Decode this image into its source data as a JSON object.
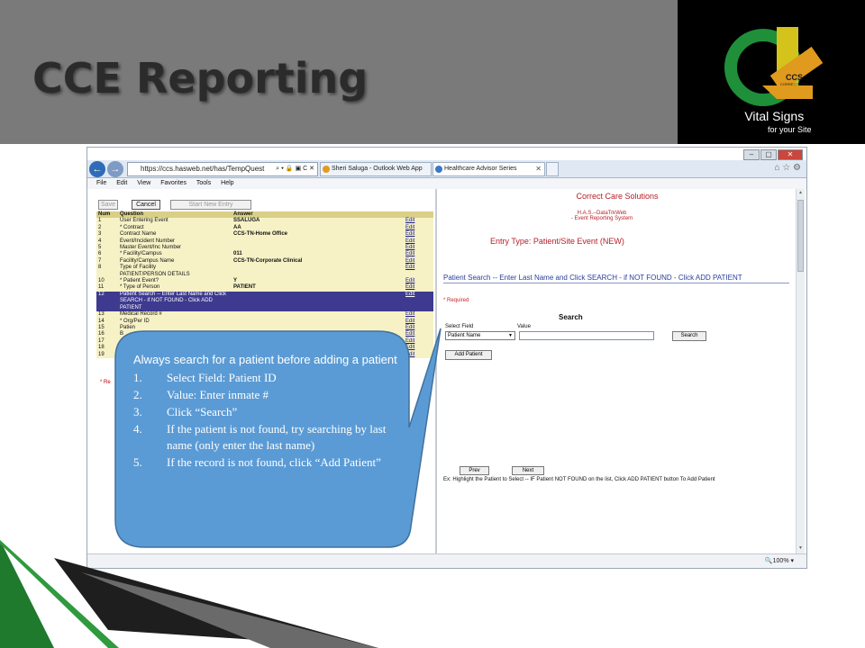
{
  "slide": {
    "title": "CCE Reporting",
    "logo": {
      "brand_text": "CCS",
      "brand_sub": "CORRECT CARE",
      "tagline_line1": "Vital Signs",
      "tagline_line2": "for your Site"
    },
    "colors": {
      "header_gray": "#7a7a7a",
      "logo_green": "#1f8f3a",
      "logo_yellow": "#d4c31a",
      "logo_orange": "#e09a1d",
      "callout_blue": "#5b9bd5",
      "swoosh_green": "#1f7a2e"
    }
  },
  "browser": {
    "address": "https://ccs.hasweb.net/has/TempQuest",
    "address_icons": "⌕ ▾ 🔒 ▣ C ✕",
    "tabs": [
      {
        "label": "Sheri Saluga - Outlook Web App"
      },
      {
        "label": "Healthcare Advisor Series",
        "close": "✕"
      }
    ],
    "toolbar_icons": "⌂ ☆ ⚙",
    "menu": [
      "File",
      "Edit",
      "View",
      "Favorites",
      "Tools",
      "Help"
    ],
    "window_buttons": {
      "minimize": "–",
      "maximize": "▢",
      "close": "✕"
    },
    "zoom": "🔍100%  ▾"
  },
  "left_pane": {
    "buttons": {
      "save": "Save",
      "cancel": "Cancel",
      "start_new": "Start New Entry"
    },
    "columns": [
      "Num",
      "Question",
      "Answer",
      ""
    ],
    "rows": [
      {
        "num": "1",
        "question": "User Entering Event",
        "answer": "SSALUGA",
        "edit": "Edit"
      },
      {
        "num": "2",
        "question": "* Contract",
        "answer": "AA",
        "edit": "Edit"
      },
      {
        "num": "3",
        "question": "Contract Name",
        "answer": "CCS-TN-Home Office",
        "edit": "Edit"
      },
      {
        "num": "4",
        "question": "Event/Incident Number",
        "answer": "",
        "edit": "Edit"
      },
      {
        "num": "5",
        "question": "Master Event/Inc Number",
        "answer": "",
        "edit": "Edit"
      },
      {
        "num": "6",
        "question": "* Facility/Campus",
        "answer": "011",
        "edit": "Edit"
      },
      {
        "num": "7",
        "question": "Facility/Campus Name",
        "answer": "CCS-TN-Corporate Clinical",
        "edit": "Edit"
      },
      {
        "num": "8",
        "question": "Type of Facility",
        "answer": "",
        "edit": "Edit"
      },
      {
        "num": "",
        "question": "PATIENT/PERSON DETAILS",
        "answer": "",
        "edit": ""
      },
      {
        "num": "10",
        "question": "* Patient Event?",
        "answer": "Y",
        "edit": "Edit"
      },
      {
        "num": "11",
        "question": "* Type of Person",
        "answer": "PATIENT",
        "edit": "Edit"
      },
      {
        "num": "12",
        "question": "Patient Search -- Enter Last Name and Click SEARCH - if NOT FOUND - Click ADD PATIENT",
        "answer": "",
        "edit": "Edit",
        "selected": true
      },
      {
        "num": "13",
        "question": "Medical Record #",
        "answer": "",
        "edit": "Edit"
      },
      {
        "num": "14",
        "question": "* Org/Per ID",
        "answer": "",
        "edit": "Edit"
      },
      {
        "num": "15",
        "question": "Patien",
        "answer": "",
        "edit": "Edit"
      },
      {
        "num": "16",
        "question": "B",
        "answer": "",
        "edit": "Edit"
      },
      {
        "num": "17",
        "question": "",
        "answer": "",
        "edit": "Edit"
      },
      {
        "num": "18",
        "question": "",
        "answer": "",
        "edit": "Edit"
      },
      {
        "num": "19",
        "question": "",
        "answer": "",
        "edit": "Edit"
      }
    ],
    "required_note": "* Re"
  },
  "right_pane": {
    "company": "Correct Care Solutions",
    "has_line1": "H.A.S.--DataTrkWeb",
    "has_line2": "- Event Reporting System",
    "entry_type": "Entry Type: Patient/Site Event (NEW)",
    "search_heading": "Patient Search -- Enter Last Name and Click SEARCH - if NOT FOUND - Click ADD PATIENT",
    "required": "* Required",
    "search_label": "Search",
    "select_field_label": "Select Field",
    "value_label": "Value",
    "select_value": "Patient Name",
    "search_button": "Search",
    "add_patient_button": "Add Patient",
    "prev_button": "Prev",
    "next_button": "Next",
    "hint": "Ex: Highlight the Patient to Select -- IF Patient NOT FOUND on the list, Click ADD PATIENT button To Add Patient"
  },
  "callout": {
    "intro": "Always search for a patient before adding a patient",
    "steps": [
      {
        "num": "1.",
        "text": "Select Field:  Patient ID"
      },
      {
        "num": "2.",
        "text": "Value:  Enter inmate #"
      },
      {
        "num": "3.",
        "text": "Click “Search”"
      },
      {
        "num": "4.",
        "text": "If the patient is not found, try searching by last name (only enter the last name)"
      },
      {
        "num": "5.",
        "text": "If the record is not found, click “Add Patient”"
      }
    ]
  }
}
